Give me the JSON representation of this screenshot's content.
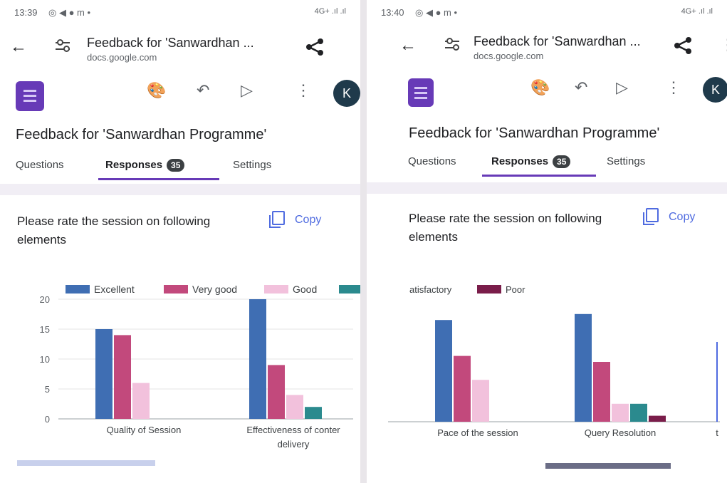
{
  "left": {
    "status": {
      "time": "13:39",
      "icons": "◎ ◀ ● m •",
      "signal": "4G+ .ıl .ıl"
    },
    "browser": {
      "page_title": "Feedback for 'Sanwardhan ...",
      "domain": "docs.google.com"
    },
    "toolbar": {
      "avatar": "K"
    },
    "form": {
      "title": "Feedback for 'Sanwardhan Programme'",
      "tabs": [
        {
          "label": "Questions"
        },
        {
          "label": "Responses",
          "badge": "35"
        },
        {
          "label": "Settings"
        }
      ],
      "question": "Please rate the session on following elements",
      "copy_label": "Copy"
    },
    "chart_data": {
      "type": "bar",
      "legend": [
        {
          "name": "Excellent",
          "color": "#3f6eb3"
        },
        {
          "name": "Very good",
          "color": "#c2497c"
        },
        {
          "name": "Good",
          "color": "#f2c1dc"
        },
        {
          "name": "",
          "color": "#2b8a8e"
        }
      ],
      "ylim": [
        0,
        20
      ],
      "yticks": [
        "20",
        "15",
        "10",
        "5",
        "0"
      ],
      "categories": [
        {
          "lines": [
            "Quality of Session"
          ]
        },
        {
          "lines": [
            "Effectiveness of conter",
            "delivery"
          ]
        }
      ],
      "series": [
        {
          "name": "Excellent",
          "values": [
            15,
            20
          ]
        },
        {
          "name": "Very good",
          "values": [
            14,
            9
          ]
        },
        {
          "name": "Good",
          "values": [
            6,
            4
          ]
        },
        {
          "name": "Satisfactory",
          "values": [
            0,
            2
          ]
        }
      ]
    }
  },
  "right": {
    "status": {
      "time": "13:40",
      "icons": "◎ ◀ ● m •",
      "signal": "4G+ .ıl .ıl"
    },
    "browser": {
      "page_title": "Feedback for 'Sanwardhan ...",
      "domain": "docs.google.com"
    },
    "toolbar": {
      "avatar": "K"
    },
    "form": {
      "title": "Feedback for 'Sanwardhan Programme'",
      "tabs": [
        {
          "label": "Questions"
        },
        {
          "label": "Responses",
          "badge": "35"
        },
        {
          "label": "Settings"
        }
      ],
      "question": "Please rate the session on following elements",
      "copy_label": "Copy"
    },
    "chart_data": {
      "type": "bar",
      "legend": [
        {
          "name": "atisfactory",
          "color": "#2b8a8e",
          "swatch": false
        },
        {
          "name": "Poor",
          "color": "#7a1d4a"
        }
      ],
      "ylim": [
        0,
        20
      ],
      "categories": [
        {
          "lines": [
            "Pace of the session"
          ]
        },
        {
          "lines": [
            "Query Resolution"
          ]
        },
        {
          "lines": [
            "t"
          ]
        }
      ],
      "series": [
        {
          "name": "Excellent",
          "values": [
            17,
            18
          ]
        },
        {
          "name": "Very good",
          "values": [
            11,
            10
          ]
        },
        {
          "name": "Good",
          "values": [
            7,
            3
          ]
        },
        {
          "name": "Satisfactory",
          "values": [
            0,
            3
          ]
        },
        {
          "name": "Poor",
          "values": [
            0,
            1
          ]
        }
      ],
      "colors": [
        "#3f6eb3",
        "#c2497c",
        "#f2c1dc",
        "#2b8a8e",
        "#7a1d4a"
      ]
    }
  }
}
